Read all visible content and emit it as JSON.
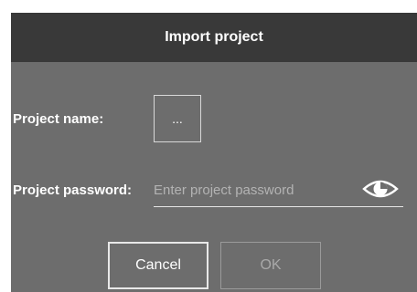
{
  "dialog": {
    "title": "Import project",
    "project_name_label": "Project name:",
    "browse_label": "...",
    "project_password_label": "Project password:",
    "password_placeholder": "Enter project password",
    "password_value": "",
    "show_password_icon": "eye-icon",
    "cancel_label": "Cancel",
    "ok_label": "OK",
    "ok_enabled": false
  },
  "colors": {
    "header_bg": "#393939",
    "dialog_bg": "#6d6d6d",
    "text": "#ffffff",
    "disabled_text": "#a9a9a9",
    "placeholder": "#b3b3b3"
  }
}
